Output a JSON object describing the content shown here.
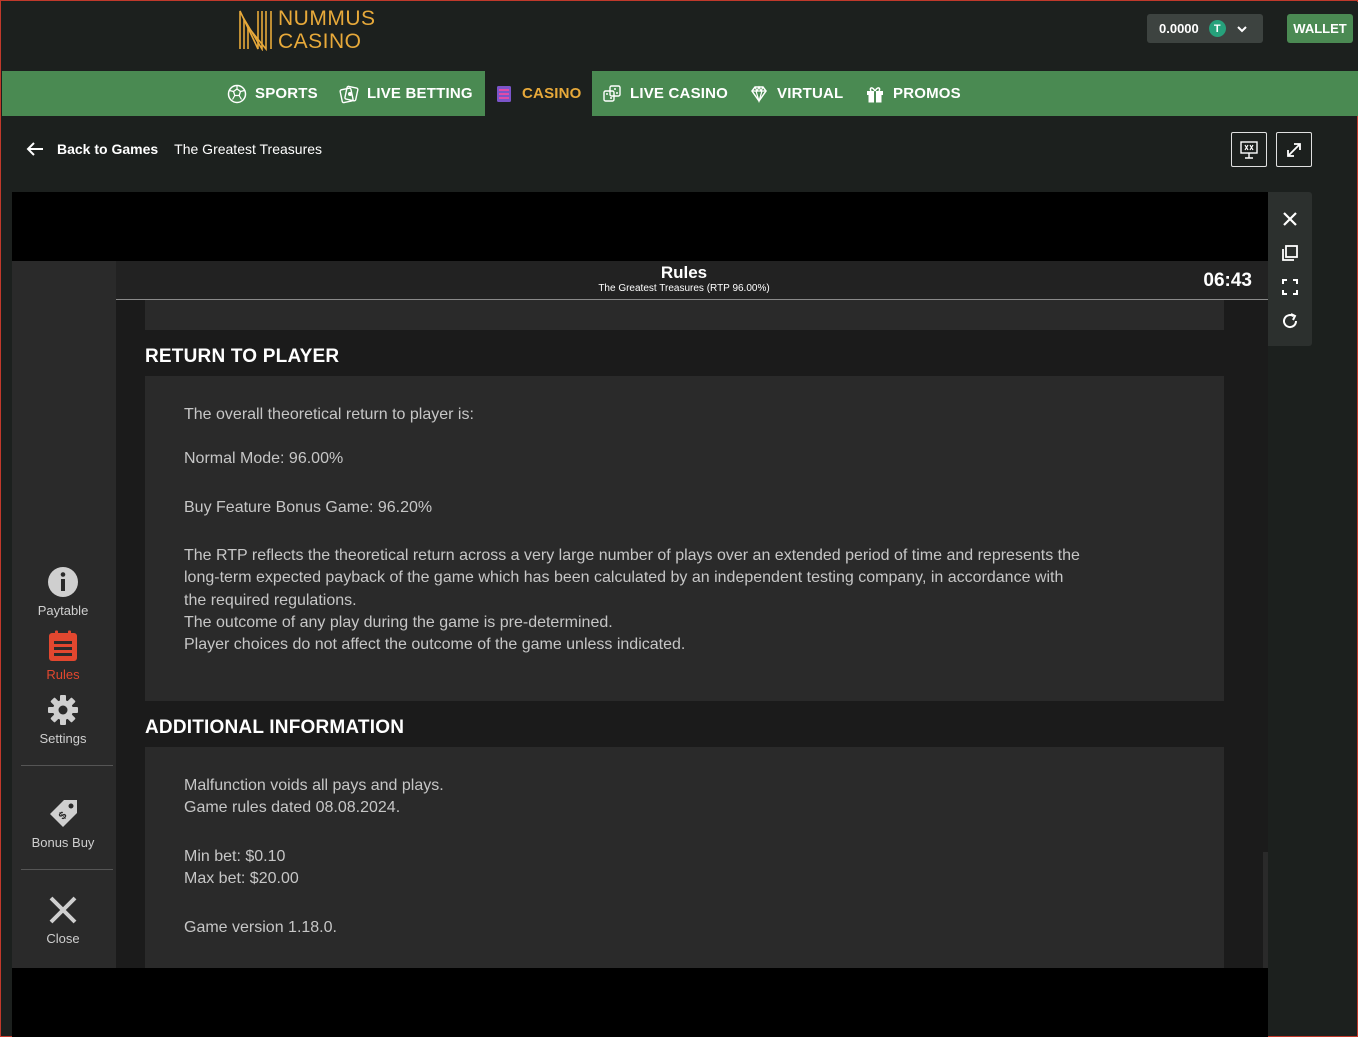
{
  "brand": {
    "line1": "NUMMUS",
    "line2": "CASINO",
    "accent_color": "#e7a93a"
  },
  "header": {
    "balance": "0.0000",
    "currency_symbol": "T",
    "wallet_label": "WALLET"
  },
  "nav": {
    "items": [
      {
        "label": "SPORTS",
        "icon": "soccer-ball-icon"
      },
      {
        "label": "LIVE BETTING",
        "icon": "live-cards-icon"
      },
      {
        "label": "CASINO",
        "icon": "slot-machine-icon",
        "active": true
      },
      {
        "label": "LIVE CASINO",
        "icon": "dice-icon"
      },
      {
        "label": "VIRTUAL",
        "icon": "diamond-icon"
      },
      {
        "label": "PROMOS",
        "icon": "gift-icon"
      }
    ]
  },
  "subheader": {
    "back_label": "Back to Games",
    "game_title": "The Greatest Treasures"
  },
  "game_menu": {
    "items": [
      {
        "label": "Paytable",
        "icon": "info-icon"
      },
      {
        "label": "Rules",
        "icon": "rules-list-icon",
        "active": true
      },
      {
        "label": "Settings",
        "icon": "gear-icon"
      },
      {
        "label": "Bonus Buy",
        "icon": "price-tag-icon"
      },
      {
        "label": "Close",
        "icon": "close-icon"
      }
    ]
  },
  "rules_panel": {
    "title": "Rules",
    "subtitle": "The Greatest Treasures (RTP 96.00%)",
    "clock": "06:43"
  },
  "sections": {
    "rtp": {
      "heading": "RETURN TO PLAYER",
      "p1": "The overall theoretical return to player is:",
      "p2": "Normal Mode: 96.00%",
      "p3": "Buy Feature Bonus Game: 96.20%",
      "p4_l1": "The RTP reflects the theoretical return across a very large number of plays over an extended period of time and represents the",
      "p4_l2": "long-term expected payback of the game which has been calculated by an independent testing company, in accordance with",
      "p4_l3": "the required regulations.",
      "p4_l4": "The outcome of any play during the game is pre-determined.",
      "p4_l5": "Player choices do not affect the outcome of the game unless indicated."
    },
    "additional": {
      "heading": "ADDITIONAL INFORMATION",
      "l1": "Malfunction voids all pays and plays.",
      "l2": "Game rules dated 08.08.2024.",
      "l3": "Min bet: $0.10",
      "l4": "Max bet: $20.00",
      "l5": "Game version 1.18.0."
    }
  },
  "colors": {
    "nav_green": "#4a8a52",
    "active_menu_red": "#e2472f",
    "tether_green": "#26a17b"
  }
}
